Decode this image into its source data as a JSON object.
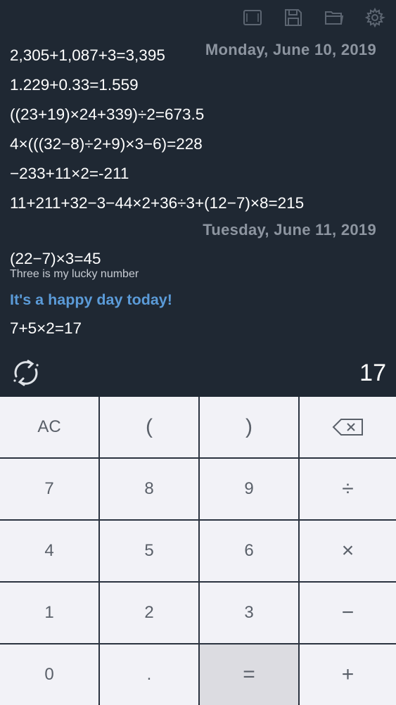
{
  "toolbar": {
    "icons": [
      "screen-icon",
      "save-icon",
      "folder-icon",
      "settings-icon"
    ]
  },
  "history": {
    "dates": [
      "Monday, June 10, 2019",
      "Tuesday, June 11, 2019"
    ],
    "day1": [
      "2,305+1,087+3=3,395",
      "1.229+0.33=1.559",
      "((23+19)×24+339)÷2=673.5",
      "4×(((32−8)÷2+9)×3−6)=228",
      "−233+11×2=-211",
      "11+211+32−3−44×2+36÷3+(12−7)×8=215"
    ],
    "day2_expr1": "(22−7)×3=45",
    "day2_note": "Three is my lucky number",
    "day2_comment": "It's a happy day today!",
    "day2_expr2": "7+5×2=17"
  },
  "result": "17",
  "keys": {
    "ac": "AC",
    "lparen": "(",
    "rparen": ")",
    "k7": "7",
    "k8": "8",
    "k9": "9",
    "divide": "÷",
    "k4": "4",
    "k5": "5",
    "k6": "6",
    "multiply": "×",
    "k1": "1",
    "k2": "2",
    "k3": "3",
    "minus": "−",
    "k0": "0",
    "dot": ".",
    "equals": "=",
    "plus": "+"
  },
  "colors": {
    "background": "#1f2833",
    "date": "#8d95a0",
    "comment": "#5b9bd8",
    "key": "#f2f2f7",
    "equals_key": "#dcdce1"
  }
}
